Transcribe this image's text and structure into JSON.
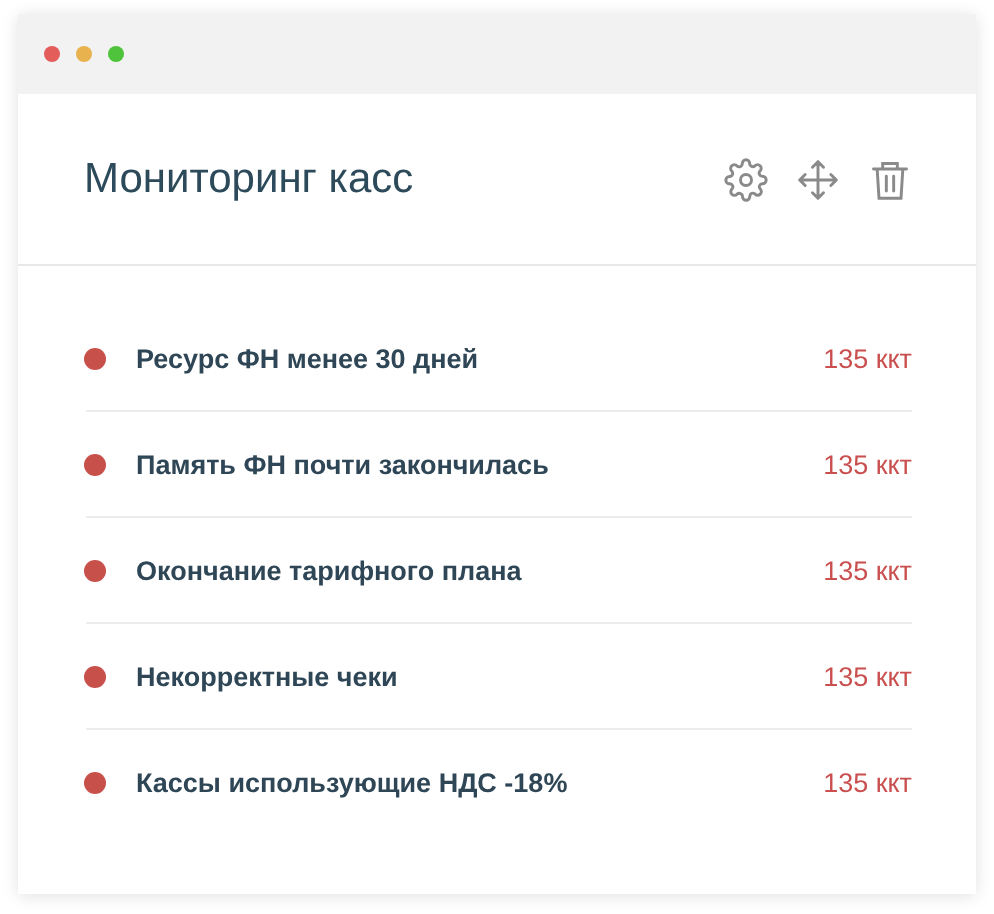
{
  "window": {
    "title": "Мониторинг касс"
  },
  "rows": [
    {
      "label": "Ресурс ФН менее 30 дней",
      "count": "135 ккт"
    },
    {
      "label": "Память ФН почти закончилась",
      "count": "135 ккт"
    },
    {
      "label": "Окончание тарифного плана",
      "count": "135 ккт"
    },
    {
      "label": "Некорректные чеки",
      "count": "135 ккт"
    },
    {
      "label": "Кассы использующие НДС -18%",
      "count": "135 ккт"
    }
  ]
}
